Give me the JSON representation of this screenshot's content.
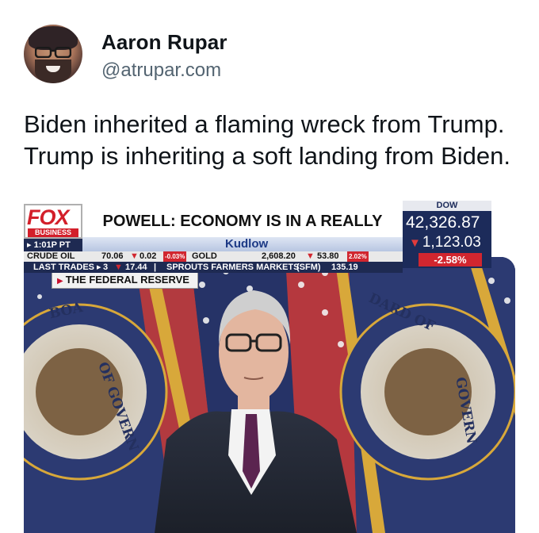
{
  "post": {
    "author_name": "Aaron Rupar",
    "author_handle": "@atrupar.com",
    "text": "Biden inherited a flaming wreck from Trump. Trump is inheriting a soft landing from Biden."
  },
  "media": {
    "tag": "THE FEDERAL RESERVE",
    "seal_text_left": "BOA",
    "seal_text_left_2": "OF GOVERN",
    "seal_text_right": "DARD OF",
    "seal_text_right_2": "GOVERN",
    "network": "FOX",
    "network_sub": "BUSINESS",
    "headline": "POWELL: ECONOMY IS IN A REALLY GOOD PLACE",
    "time": "1:01P PT",
    "show": "Kudlow",
    "dow_label": "DOW",
    "dow_value": "42,326.87",
    "dow_change": "1,123.03",
    "dow_pct": "-2.58%",
    "ticker_row1": {
      "crude_label": "CRUDE OIL",
      "crude_value": "70.06",
      "crude_change": "0.02",
      "crude_pct": "-0.03%",
      "gold_label": "GOLD",
      "gold_value": "2,608.20",
      "gold_change": "53.80",
      "gold_pct": "2.02%"
    },
    "ticker_row2": {
      "label": "LAST TRADES",
      "left_num": "3",
      "left_value": "17.44",
      "stock": "SPROUTS FARMERS MARKETS",
      "symbol": "SFM",
      "price": "135.19"
    }
  },
  "colors": {
    "fox_red": "#d31f2a",
    "fox_navy": "#1e2a52",
    "handle_grey": "#536471"
  }
}
